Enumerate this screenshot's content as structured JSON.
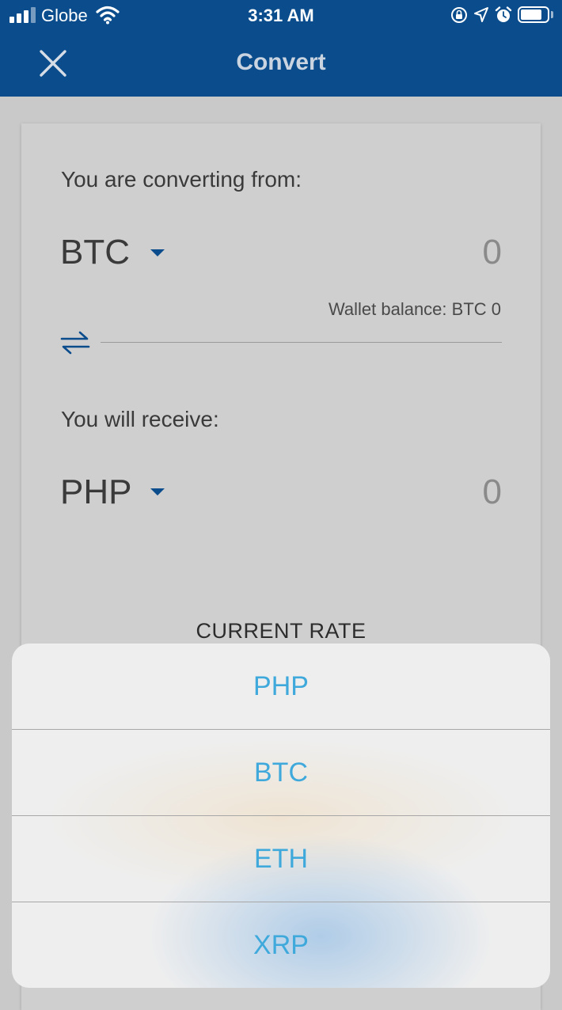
{
  "status_bar": {
    "carrier": "Globe",
    "time": "3:31 AM"
  },
  "nav": {
    "title": "Convert"
  },
  "form": {
    "from_label": "You are converting from:",
    "from_currency": "BTC",
    "from_amount": "0",
    "wallet_balance": "Wallet balance: BTC  0",
    "to_label": "You will receive:",
    "to_currency": "PHP",
    "to_amount": "0",
    "current_rate_label": "CURRENT RATE"
  },
  "picker": {
    "options": [
      {
        "label": "PHP"
      },
      {
        "label": "BTC"
      },
      {
        "label": "ETH"
      },
      {
        "label": "XRP"
      }
    ]
  },
  "colors": {
    "brand": "#0a4c8c",
    "option_text": "#3fa9dc",
    "overlay_background": "#c9c9c9"
  }
}
